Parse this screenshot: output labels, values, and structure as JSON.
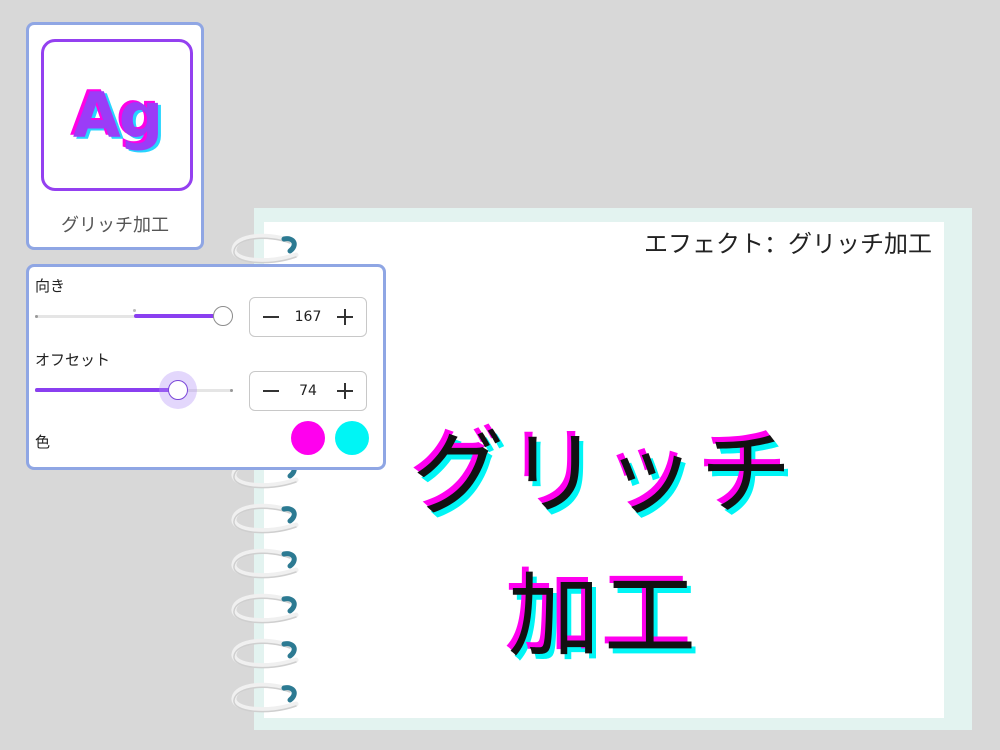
{
  "effect_card": {
    "thumbnail_text": "Ag",
    "label": "グリッチ加工"
  },
  "settings": {
    "direction": {
      "label": "向き",
      "value": "167",
      "slider_level": 0.95,
      "slider_fill_from": 0.5
    },
    "offset": {
      "label": "オフセット",
      "value": "74",
      "slider_level": 0.72,
      "slider_fill_from": 0.0
    },
    "color": {
      "label": "色",
      "swatch1": "#ff00ee",
      "swatch2": "#00f5f5"
    }
  },
  "notebook": {
    "caption": "エフェクト：グリッチ加工",
    "line1": "グリッチ",
    "line2": "加工"
  },
  "colors": {
    "accent": "#8a3ff0",
    "card_border": "#8fa6e4",
    "ring_color": "#2c7a92"
  }
}
